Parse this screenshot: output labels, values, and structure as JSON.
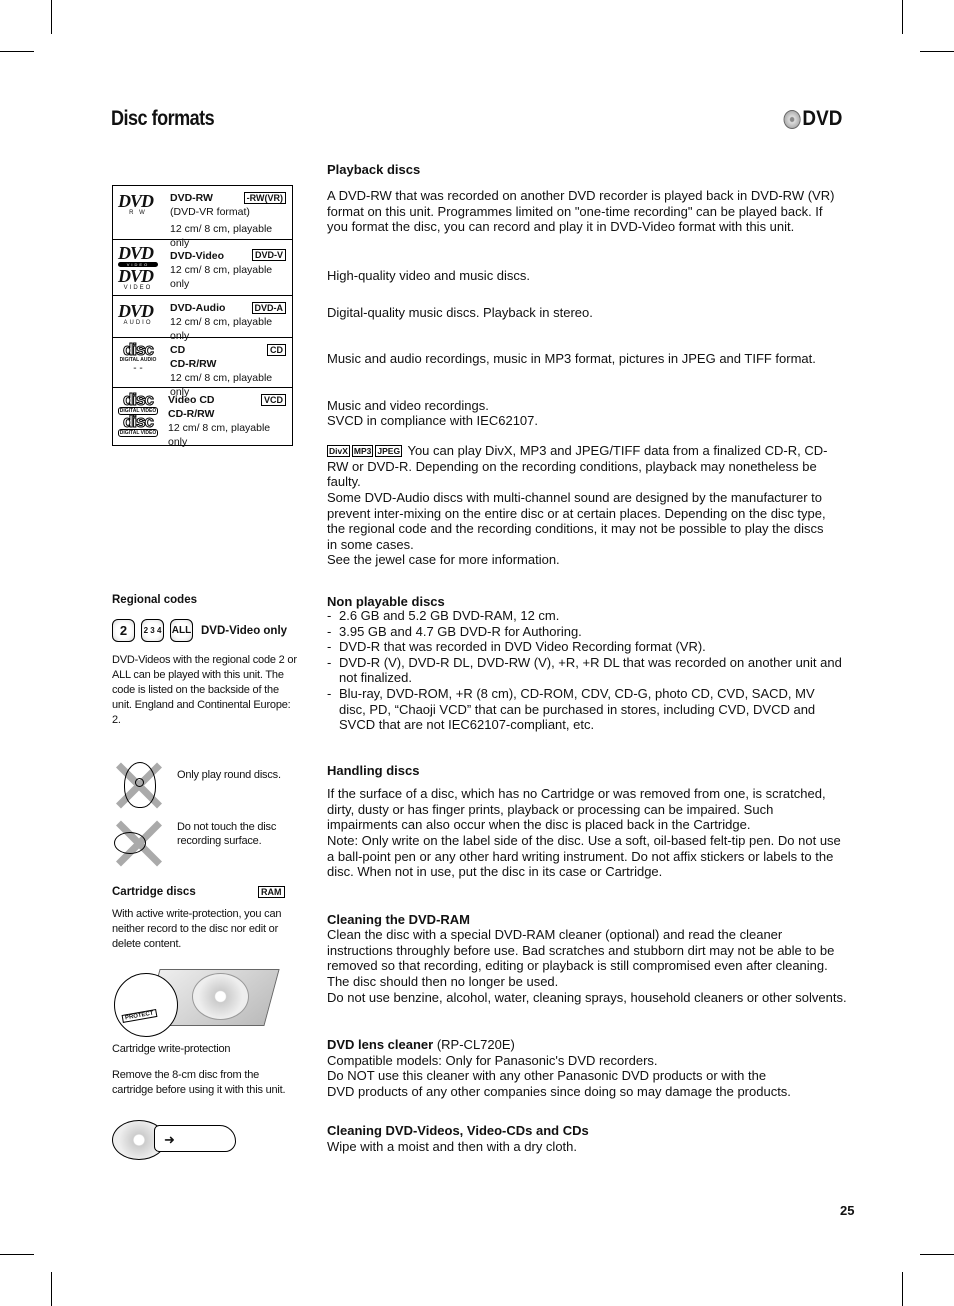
{
  "header": {
    "title": "Disc formats",
    "logo_text": "DVD"
  },
  "playback": {
    "heading": "Playback discs",
    "disc_table": [
      {
        "logo": "DVD",
        "logo_sub": "R W",
        "name": "DVD-RW",
        "extra": "(DVD-VR format)",
        "size": "12 cm/ 8 cm, playable only",
        "badge": "-RW(VR)"
      },
      {
        "logo": "DVD",
        "logo_sub": "VIDEO",
        "name": "DVD-Video",
        "size": "12 cm/ 8 cm, playable only",
        "badge": "DVD-V"
      },
      {
        "logo": "DVD",
        "logo_sub": "AUDIO",
        "name": "DVD-Audio",
        "size": "12 cm/ 8 cm, playable only",
        "badge": "DVD-A"
      },
      {
        "logo": "disc",
        "logo_sub": "DIGITAL AUDIO",
        "logo_extra": "- -",
        "name": "CD",
        "name2": "CD-R/RW",
        "size": "12 cm/ 8 cm, playable only",
        "badge": "CD"
      },
      {
        "logo": "disc",
        "logo_sub": "DIGITAL VIDEO",
        "name": "Video CD",
        "name2": "CD-R/RW",
        "size": "12 cm/ 8 cm, playable only",
        "badge": "VCD"
      }
    ],
    "descriptions": [
      "A DVD-RW that was recorded on another DVD recorder is played back in DVD-RW (VR) format on this unit. Programmes limited on \"one-time recording\" can be played back. If you format the disc, you can record and play it in DVD-Video format with this unit.",
      "High-quality video and music discs.",
      "Digital-quality music discs. Playback in stereo.",
      "Music and audio recordings, music in MP3 format, pictures in JPEG and TIFF format.",
      "Music and video recordings.",
      "SVCD in compliance with IEC62107."
    ],
    "format_badges": [
      "DivX",
      "MP3",
      "JPEG"
    ],
    "format_note": "You can play DivX, MP3 and JPEG/TIFF data from a finalized CD-R, CD-RW or DVD-R. Depending on the recording conditions, playback may nonetheless be faulty.",
    "audio_note": "Some DVD-Audio discs with multi-channel sound are designed by the manufacturer to prevent inter-mixing on the entire disc or at certain places. Depending on the disc type, the regional code and the recording conditions, it may not be possible to play the discs in some cases.",
    "jewel_note": "See the jewel case for more information."
  },
  "regional": {
    "heading": "Regional codes",
    "codes": [
      "2",
      "2 3 4",
      "ALL"
    ],
    "label": "DVD-Video only",
    "text": "DVD-Videos with the regional code 2 or ALL can be played with this unit. The code is listed on the backside of the unit. England and Continental Europe: 2."
  },
  "non_playable": {
    "heading": "Non playable discs",
    "items": [
      "2.6 GB and 5.2 GB DVD-RAM, 12 cm.",
      "3.95 GB and 4.7 GB DVD-R for Authoring.",
      "DVD-R that was recorded in DVD Video Recording format (VR).",
      "DVD-R (V), DVD-R DL, DVD-RW (V), +R, +R DL that was recorded on another unit and not finalized.",
      "Blu-ray, DVD-ROM, +R (8 cm), CD-ROM, CDV, CD-G, photo CD, CVD, SACD, MV disc, PD, “Chaoji VCD” that can be purchased in stores, including CVD, DVCD and SVCD that are not IEC62107-compliant, etc."
    ]
  },
  "warnings": {
    "round": "Only play round discs.",
    "touch": "Do not touch the disc recording surface."
  },
  "cartridge": {
    "heading": "Cartridge discs",
    "badge": "RAM",
    "text": "With active write-protection, you can neither record to the disc nor edit or delete content.",
    "protect_label": "PROTECT",
    "caption": "Cartridge write-protection",
    "remove_note": "Remove the 8-cm disc from the cartridge before using it with this unit."
  },
  "handling": {
    "heading": "Handling discs",
    "text": "If the surface of a disc, which has no Cartridge or was removed from one, is scratched, dirty, dusty or has finger prints, playback or processing can be impaired. Such impairments can also occur when the disc is placed back in the Cartridge.",
    "note": "Note: Only write on the label side of the disc. Use a soft, oil-based felt-tip pen. Do not use a ball-point pen or any other hard writing instrument. Do not affix stickers or labels to the disc. When not in use, put the disc in its case or Cartridge."
  },
  "cleaning_ram": {
    "heading": "Cleaning the DVD-RAM",
    "text": "Clean the disc with a special DVD-RAM cleaner (optional) and read the cleaner instructions throughly before use. Bad scratches and stubborn dirt may not be able to be removed so that recording, editing or playback is still compromised even after cleaning. The disc should then no longer be used.",
    "warning": "Do not use benzine, alcohol, water, cleaning sprays, household cleaners or other solvents."
  },
  "lens_cleaner": {
    "heading": "DVD lens cleaner",
    "model": "(RP-CL720E)",
    "compat": "Compatible models: Only for Panasonic's DVD recorders.",
    "warning": "Do NOT use this cleaner with any other Panasonic DVD products or with the DVD products of any other companies since doing so may damage the products."
  },
  "cleaning_cds": {
    "heading": "Cleaning DVD-Videos, Video-CDs and CDs",
    "text": "Wipe with a moist and then with a dry cloth."
  },
  "footer": {
    "page_number": "25"
  }
}
